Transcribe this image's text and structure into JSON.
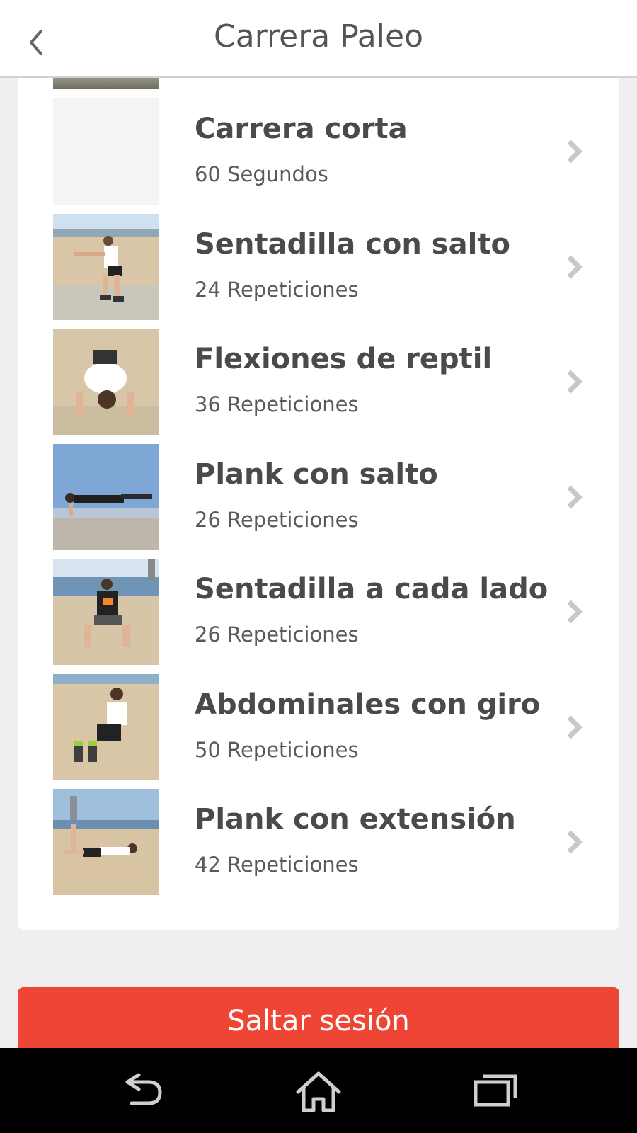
{
  "header": {
    "title": "Carrera Paleo",
    "back_icon": "chevron-left-icon"
  },
  "exercises": [
    {
      "name": "Carrera corta",
      "amount": "60 Segundos"
    },
    {
      "name": "Sentadilla con salto",
      "amount": "24 Repeticiones"
    },
    {
      "name": "Flexiones de reptil",
      "amount": "36 Repeticiones"
    },
    {
      "name": "Plank con salto",
      "amount": "26 Repeticiones"
    },
    {
      "name": "Sentadilla a cada lado",
      "amount": "26 Repeticiones"
    },
    {
      "name": "Abdominales con giro",
      "amount": "50 Repeticiones"
    },
    {
      "name": "Plank con extensión",
      "amount": "42 Repeticiones"
    }
  ],
  "skip_button": {
    "label": "Saltar sesión"
  },
  "colors": {
    "accent": "#ef4534",
    "text": "#4a4a4a",
    "chevron": "#c8c8c8",
    "navbar": "#000000"
  },
  "nav": {
    "icons": [
      "back-icon",
      "home-icon",
      "recent-apps-icon"
    ]
  }
}
